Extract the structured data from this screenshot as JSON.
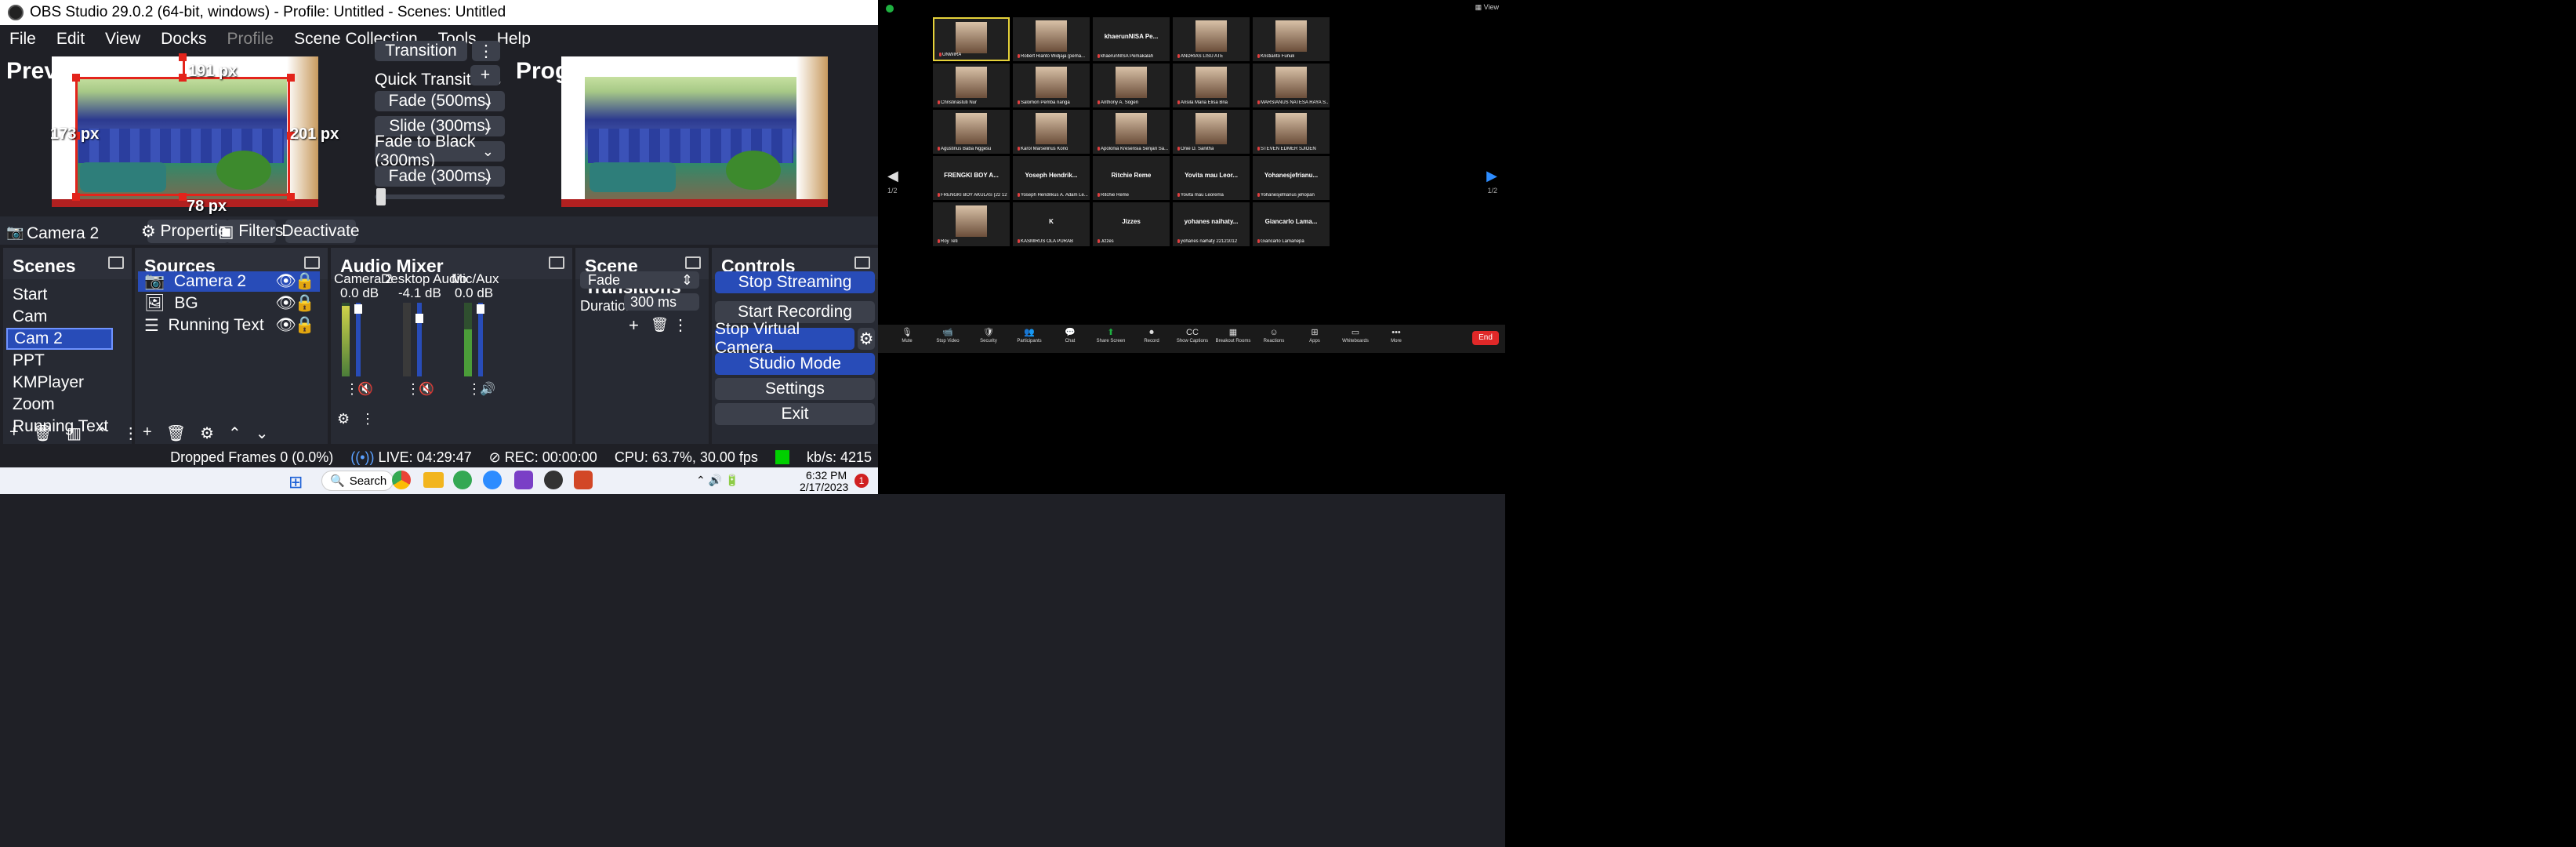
{
  "obs": {
    "title": "OBS Studio 29.0.2 (64-bit, windows) - Profile: Untitled - Scenes: Untitled",
    "menu": [
      "File",
      "Edit",
      "View",
      "Docks",
      "Profile",
      "Scene Collection",
      "Tools",
      "Help"
    ],
    "preview_label": "Preview: Cam 2",
    "program_label": "Program: Cam 2",
    "dims": {
      "top": "191 px",
      "left": "173 px",
      "right": "201 px",
      "bottom": "78 px"
    },
    "transition_btn": "Transition",
    "quick_transitions": "Quick Transitions",
    "quick_list": [
      "Fade (500ms)",
      "Slide (300ms)",
      "Fade to Black (300ms)",
      "Fade (300ms)"
    ],
    "source_bar": {
      "name": "Camera 2",
      "properties": "Properties",
      "filters": "Filters",
      "deactivate": "Deactivate"
    },
    "scenes": {
      "title": "Scenes",
      "items": [
        "Start",
        "Cam",
        "Cam 2",
        "PPT",
        "KMPlayer",
        "Zoom",
        "Running Text"
      ],
      "selected_index": 2
    },
    "sources": {
      "title": "Sources",
      "items": [
        "Camera 2",
        "BG",
        "Running Text"
      ]
    },
    "audio": {
      "title": "Audio Mixer",
      "channels": [
        {
          "name": "Camera 2",
          "db": "0.0 dB"
        },
        {
          "name": "Desktop Audio",
          "db": "-4.1 dB"
        },
        {
          "name": "Mic/Aux",
          "db": "0.0 dB"
        }
      ],
      "scale": [
        "0",
        "-5",
        "-10",
        "-15",
        "-20",
        "-25",
        "-30",
        "-35",
        "-40",
        "-45",
        "-50",
        "-55",
        "-60"
      ]
    },
    "transitions": {
      "title": "Scene Transitions",
      "selected": "Fade",
      "duration_label": "Duration",
      "duration": "300 ms"
    },
    "controls": {
      "title": "Controls",
      "buttons": [
        "Stop Streaming",
        "Start Recording",
        "Stop Virtual Camera",
        "Studio Mode",
        "Settings",
        "Exit"
      ]
    },
    "status": {
      "dropped": "Dropped Frames 0 (0.0%)",
      "live": "LIVE: 04:29:47",
      "rec": "REC: 00:00:00",
      "cpu": "CPU: 63.7%, 30.00 fps",
      "kbs": "kb/s: 4215"
    }
  },
  "taskbar": {
    "search": "Search",
    "time": "6:32 PM",
    "date": "2/17/2023",
    "notif": "1",
    "chrome_badge": "1",
    "zoom_badge": "1"
  },
  "zoom": {
    "view": "View",
    "page": "1/2",
    "page_right": "1/2",
    "tiles": [
      {
        "name": "UNWIRA",
        "big": ""
      },
      {
        "name": "Robert Rianto Widjaja (pema...",
        "big": ""
      },
      {
        "name": "khaerunNISA Pemakalah",
        "big": "khaerunNISA  Pe..."
      },
      {
        "name": "ANDRIAS LISU ATE",
        "big": ""
      },
      {
        "name": "Kristianto Funuk",
        "big": ""
      },
      {
        "name": "Christinastuti Nur",
        "big": ""
      },
      {
        "name": "Salomon Pemba nanga",
        "big": ""
      },
      {
        "name": "Anthony A. Sogen",
        "big": ""
      },
      {
        "name": "Ansila Maria Elisa Bria",
        "big": ""
      },
      {
        "name": "MARSIANUS NATESA RAYA S...",
        "big": ""
      },
      {
        "name": "Agustinus Baba Nggesu",
        "big": ""
      },
      {
        "name": "Karol Marselinus Kono",
        "big": ""
      },
      {
        "name": "Apolonia Kresensia Senjari Sa...",
        "big": ""
      },
      {
        "name": "Onie D. Sanitha",
        "big": ""
      },
      {
        "name": "STEVEN EDMER SJIOEN",
        "big": ""
      },
      {
        "name": "FRENGKI BOY AKULAS (22 12 ...",
        "big": "FRENGKI BOY A..."
      },
      {
        "name": "Yoseph Hendrikus A. Adam Le...",
        "big": "Yoseph  Hendrik..."
      },
      {
        "name": "Ritchie Reme",
        "big": "Ritchie Reme"
      },
      {
        "name": "Yovita mau Leorema",
        "big": "Yovita mau Leor..."
      },
      {
        "name": "Yohanesjefrianus jehopan",
        "big": "Yohanesjefrianu..."
      },
      {
        "name": "Roy Teti",
        "big": ""
      },
      {
        "name": "KASMIRUS OLA PURAB",
        "big": "K"
      },
      {
        "name": "Jizzes",
        "big": "Jizzes"
      },
      {
        "name": "yohanes naihaty 22121012",
        "big": "yohanes  naihaty..."
      },
      {
        "name": "Giancarlo Lamanepa",
        "big": "Giancarlo  Lama..."
      }
    ],
    "toolbar": [
      {
        "g": "🎙",
        "l": "Mute"
      },
      {
        "g": "📹",
        "l": "Stop Video"
      },
      {
        "g": "🛡",
        "l": "Security"
      },
      {
        "g": "👥",
        "l": "Participants",
        "badge": "26"
      },
      {
        "g": "💬",
        "l": "Chat"
      },
      {
        "g": "⬆",
        "l": "Share Screen"
      },
      {
        "g": "⏺",
        "l": "Record"
      },
      {
        "g": "CC",
        "l": "Show Captions"
      },
      {
        "g": "▦",
        "l": "Breakout Rooms",
        "badge": "10"
      },
      {
        "g": "☺",
        "l": "Reactions"
      },
      {
        "g": "⊞",
        "l": "Apps"
      },
      {
        "g": "▭",
        "l": "Whiteboards"
      },
      {
        "g": "•••",
        "l": "More"
      }
    ],
    "end": "End",
    "accent": "#e02828"
  }
}
